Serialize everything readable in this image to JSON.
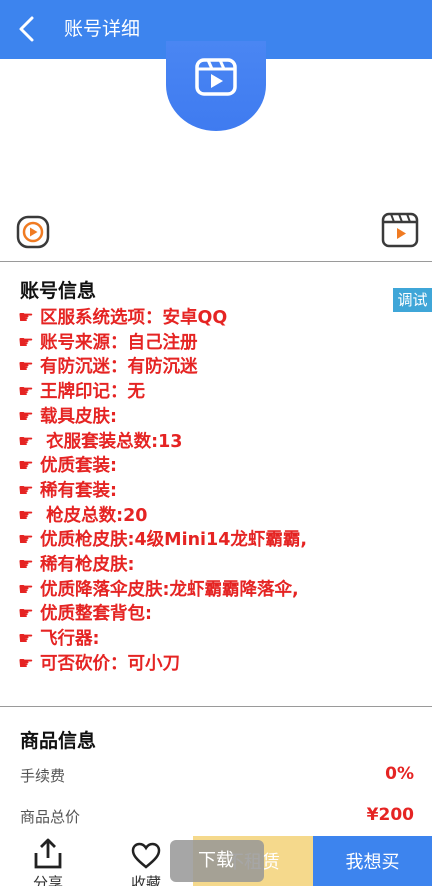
{
  "header": {
    "title": "账号详细",
    "back_icon": "back-arrow-icon"
  },
  "account_info": {
    "title": "账号信息",
    "debug_label": "调试",
    "hand_icon": "☛",
    "lines": [
      "区服系统选项：安卓QQ",
      "账号来源：自己注册",
      "有防沉迷：有防沉迷",
      "王牌印记：无",
      "载具皮肤:",
      " 衣服套装总数:13",
      "优质套装:",
      "稀有套装:",
      " 枪皮总数:20",
      "优质枪皮肤:4级Mini14龙虾霸霸,",
      "稀有枪皮肤:",
      "优质降落伞皮肤:龙虾霸霸降落伞,",
      "优质整套背包:",
      "飞行器:",
      "可否砍价：可小刀"
    ]
  },
  "goods_info": {
    "title": "商品信息",
    "fee_label": "手续费",
    "fee_value": "0%",
    "total_label": "商品总价",
    "total_value": "¥200"
  },
  "bottom_bar": {
    "share_label": "分享",
    "fav_label": "收藏",
    "no_rent_label": "不租赁",
    "download_label": "下载",
    "buy_label": "我想买"
  },
  "colors": {
    "header_blue": "#3d84ee",
    "info_red": "#e52423",
    "debug_blue": "#3fa6d8",
    "no_rent_yellow": "#f5d98c"
  }
}
